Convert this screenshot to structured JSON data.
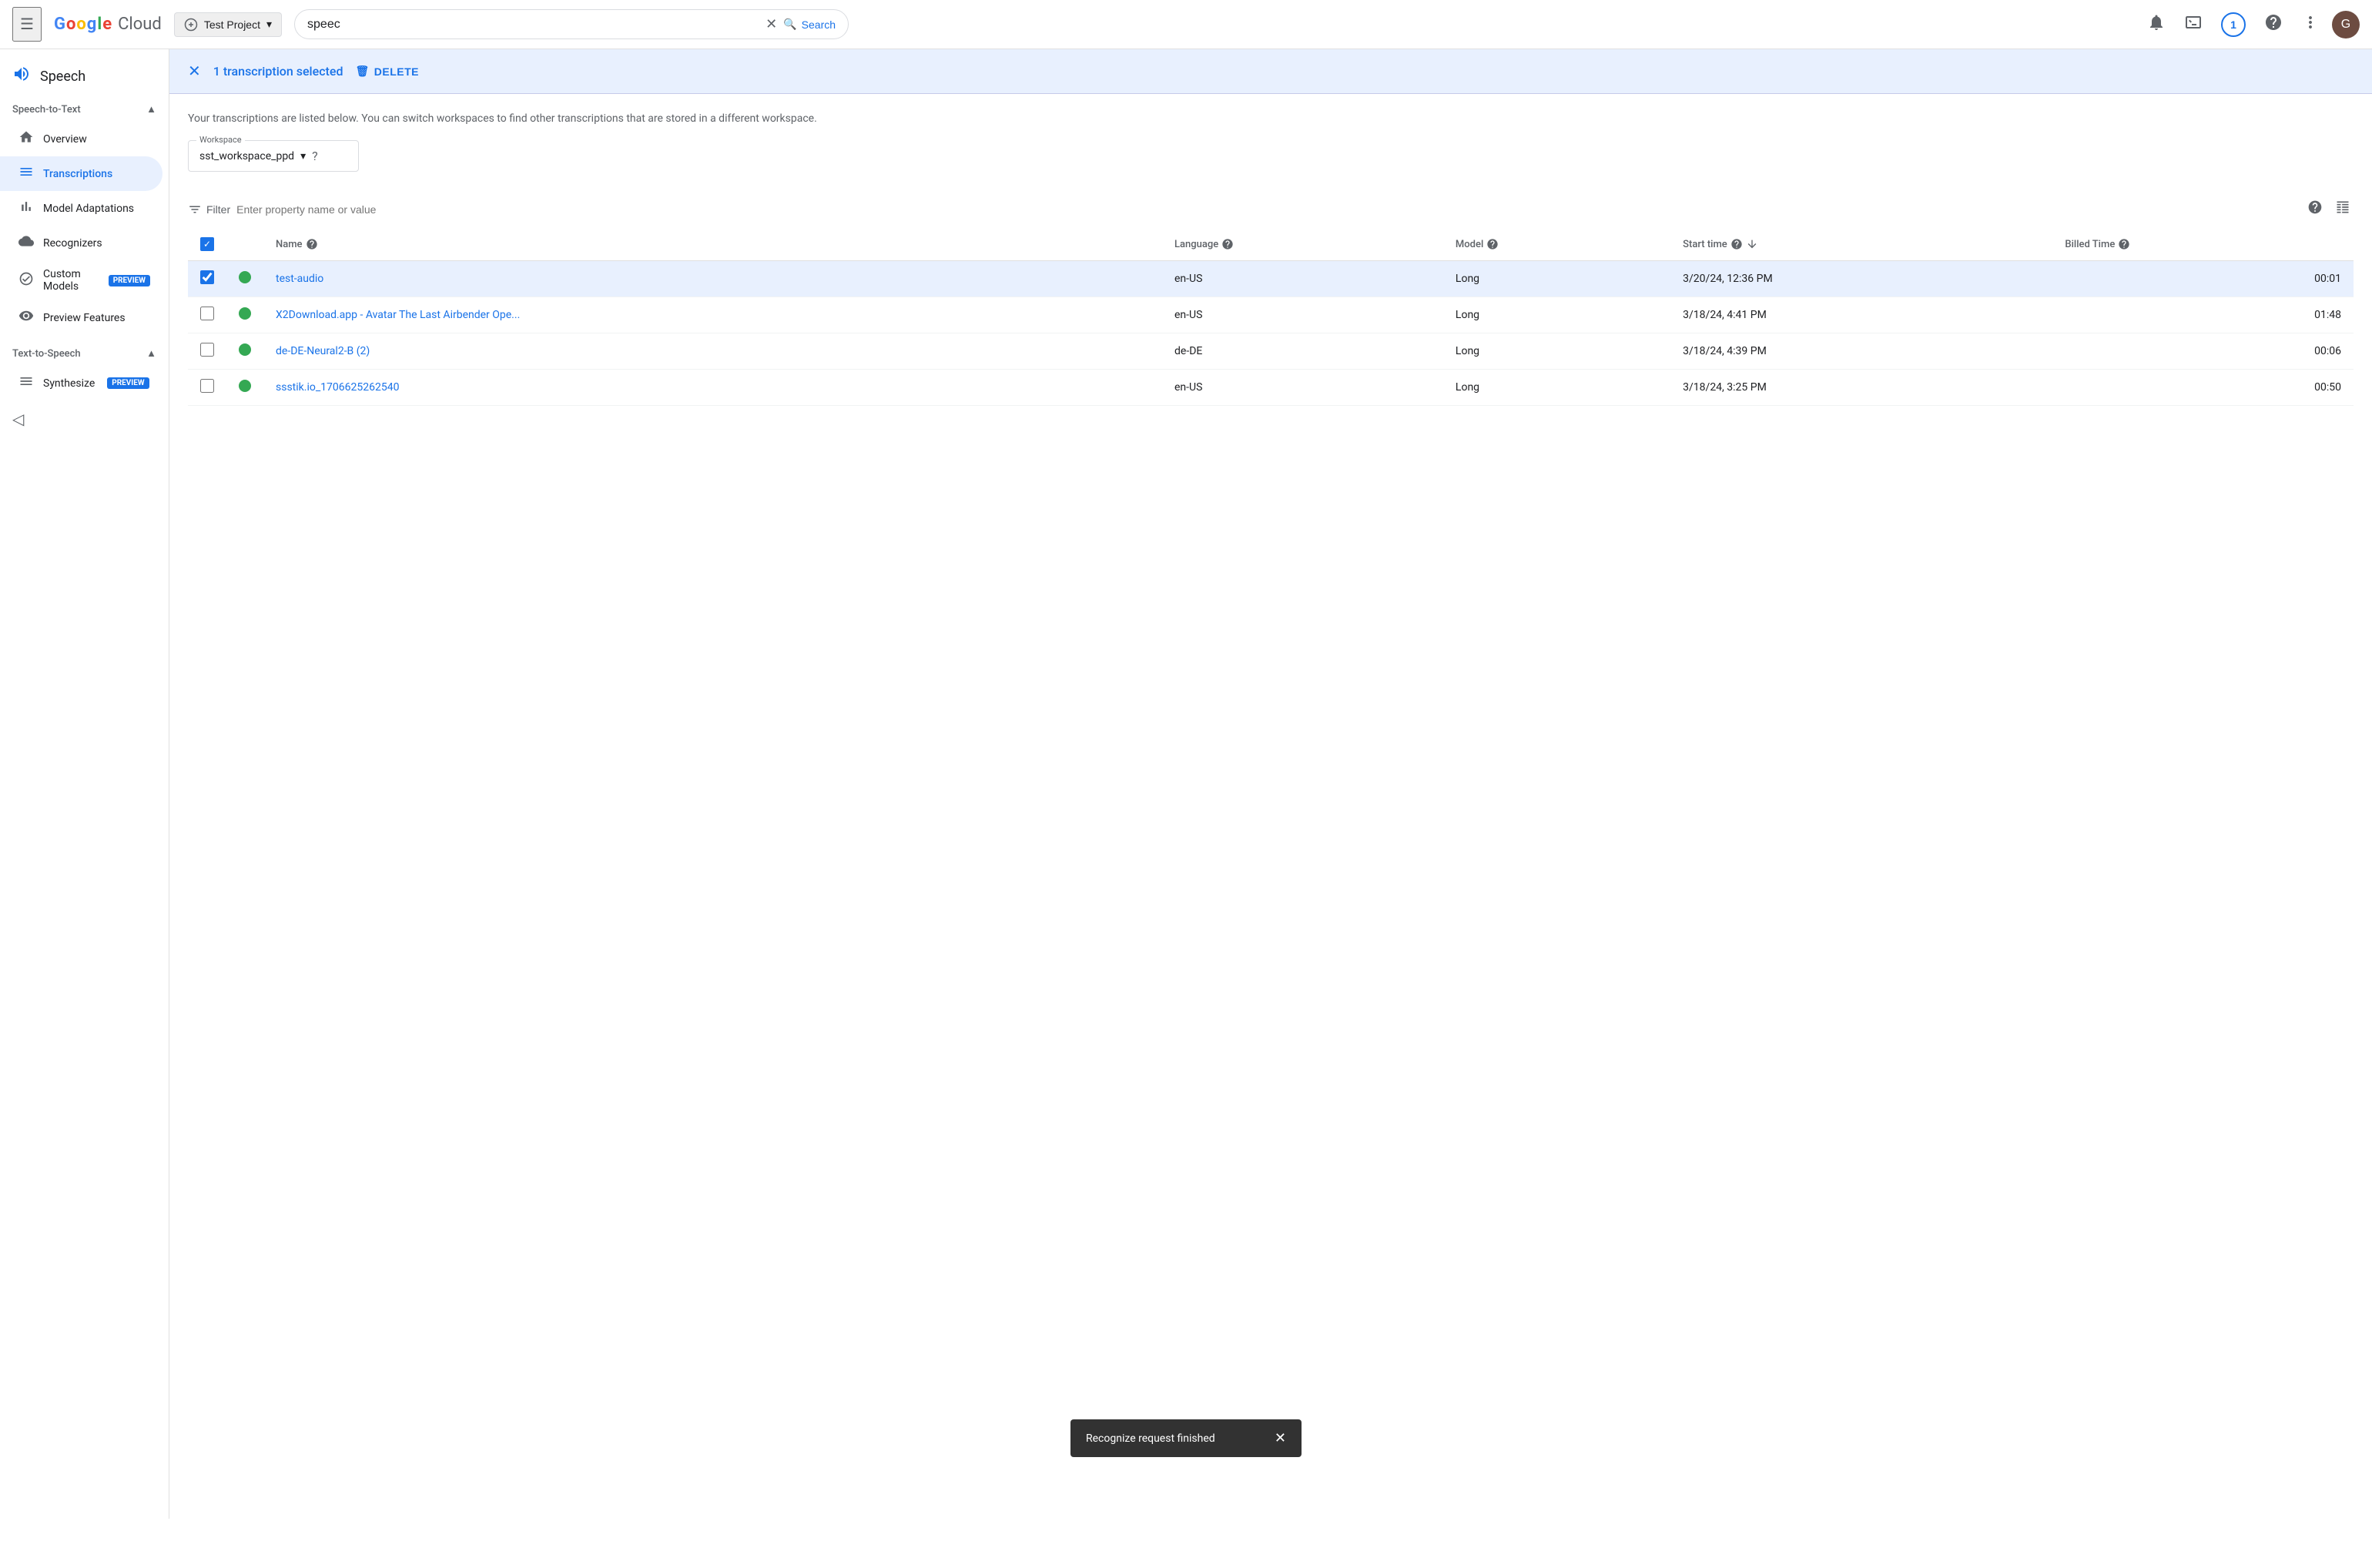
{
  "topbar": {
    "hamburger_icon": "☰",
    "logo": {
      "google": "Google",
      "cloud": "Cloud"
    },
    "project": {
      "name": "Test Project",
      "dropdown_icon": "▾"
    },
    "search": {
      "value": "speec",
      "placeholder": "Search",
      "clear_icon": "✕",
      "search_label": "Search",
      "search_icon": "🔍"
    },
    "icons": {
      "notifications": "🔔",
      "cloud_shell": "⬛",
      "badge_count": "1",
      "help": "?",
      "more": "⋮",
      "avatar": "G"
    }
  },
  "sidebar": {
    "app_icon": "📊",
    "app_title": "Speech",
    "sections": [
      {
        "id": "speech-to-text",
        "label": "Speech-to-Text",
        "expanded": true,
        "items": [
          {
            "id": "overview",
            "label": "Overview",
            "icon": "🏠",
            "active": false
          },
          {
            "id": "transcriptions",
            "label": "Transcriptions",
            "icon": "≡",
            "active": true
          },
          {
            "id": "model-adaptations",
            "label": "Model Adaptations",
            "icon": "📊",
            "active": false
          },
          {
            "id": "recognizers",
            "label": "Recognizers",
            "icon": "☁",
            "active": false
          },
          {
            "id": "custom-models",
            "label": "Custom Models",
            "icon": "⬡",
            "active": false,
            "badge": "PREVIEW"
          },
          {
            "id": "preview-features",
            "label": "Preview Features",
            "icon": "👁",
            "active": false
          }
        ]
      },
      {
        "id": "text-to-speech",
        "label": "Text-to-Speech",
        "expanded": true,
        "items": [
          {
            "id": "synthesize",
            "label": "Synthesize",
            "icon": "≡",
            "active": false,
            "badge": "PREVIEW"
          }
        ]
      }
    ],
    "collapse_icon": "◁"
  },
  "selection_bar": {
    "close_icon": "✕",
    "count_text": "1 transcription selected",
    "delete_icon": "🗑",
    "delete_label": "DELETE"
  },
  "content": {
    "description": "Your transcriptions are listed below. You can switch workspaces to find other transcriptions that are stored in a different workspace.",
    "workspace": {
      "label": "Workspace",
      "value": "sst_workspace_ppd",
      "dropdown_icon": "▾",
      "help_icon": "?"
    },
    "filter": {
      "icon": "≡",
      "label": "Filter",
      "placeholder": "Enter property name or value"
    },
    "table": {
      "help_icon": "?",
      "columns_icon": "▦",
      "columns": [
        {
          "id": "name",
          "label": "Name",
          "help": true
        },
        {
          "id": "language",
          "label": "Language",
          "help": true
        },
        {
          "id": "model",
          "label": "Model",
          "help": true
        },
        {
          "id": "start_time",
          "label": "Start time",
          "help": true,
          "sortable": true
        },
        {
          "id": "billed_time",
          "label": "Billed Time",
          "help": true
        }
      ],
      "rows": [
        {
          "id": "row-1",
          "selected": true,
          "status": "success",
          "name": "test-audio",
          "language": "en-US",
          "model": "Long",
          "start_time": "3/20/24, 12:36 PM",
          "billed_time": "00:01"
        },
        {
          "id": "row-2",
          "selected": false,
          "status": "success",
          "name": "X2Download.app - Avatar The Last Airbender Ope...",
          "language": "en-US",
          "model": "Long",
          "start_time": "3/18/24, 4:41 PM",
          "billed_time": "01:48"
        },
        {
          "id": "row-3",
          "selected": false,
          "status": "success",
          "name": "de-DE-Neural2-B (2)",
          "language": "de-DE",
          "model": "Long",
          "start_time": "3/18/24, 4:39 PM",
          "billed_time": "00:06"
        },
        {
          "id": "row-4",
          "selected": false,
          "status": "success",
          "name": "ssstik.io_1706625262540",
          "language": "en-US",
          "model": "Long",
          "start_time": "3/18/24, 3:25 PM",
          "billed_time": "00:50"
        }
      ]
    }
  },
  "snackbar": {
    "message": "Recognize request finished",
    "close_icon": "✕"
  }
}
